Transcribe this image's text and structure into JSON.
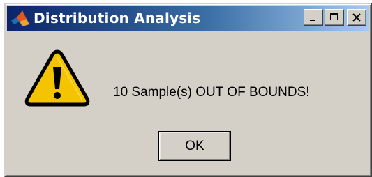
{
  "window": {
    "title": "Distribution Analysis",
    "icon": "matlab-logo-icon",
    "controls": {
      "minimize": "minimize-icon",
      "maximize": "maximize-icon",
      "close": "close-icon"
    }
  },
  "dialog": {
    "icon": "warning-icon",
    "message": "10 Sample(s) OUT OF BOUNDS!",
    "ok_label": "OK"
  },
  "colors": {
    "titlebar_start": "#0a246a",
    "titlebar_end": "#a6caf0",
    "face": "#d4d0c8",
    "warning_fill": "#f5c400"
  }
}
